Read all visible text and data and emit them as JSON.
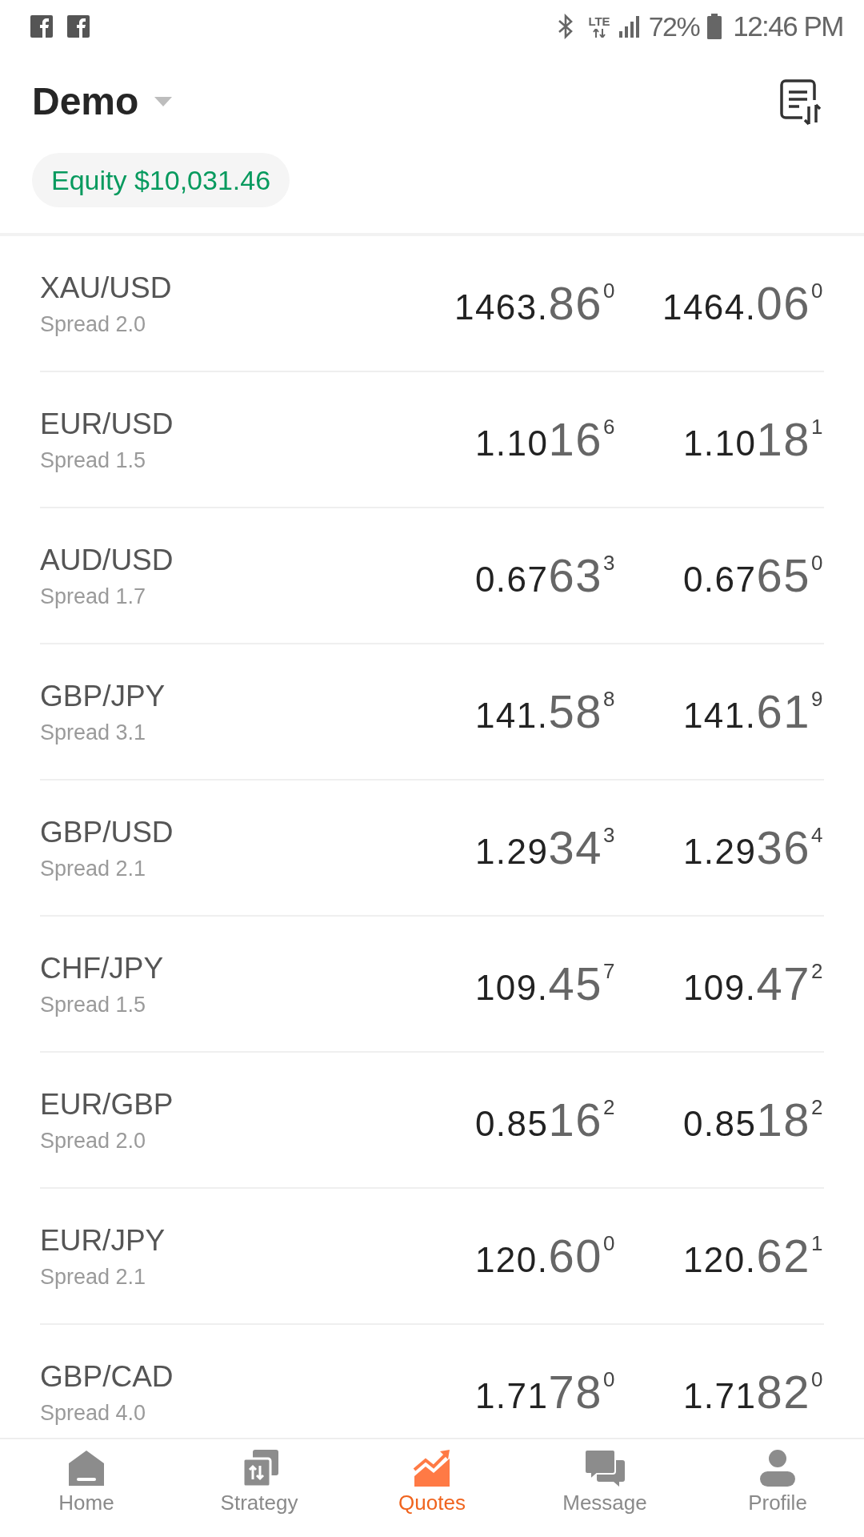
{
  "status_bar": {
    "network": "LTE",
    "battery": "72%",
    "time": "12:46 PM"
  },
  "header": {
    "account": "Demo",
    "equity": "Equity $10,031.46"
  },
  "quotes": [
    {
      "pair": "XAU/USD",
      "spread": "Spread 2.0",
      "bid": {
        "lead": "1463.",
        "pips": "86",
        "fraction": "0"
      },
      "ask": {
        "lead": "1464.",
        "pips": "06",
        "fraction": "0"
      }
    },
    {
      "pair": "EUR/USD",
      "spread": "Spread 1.5",
      "bid": {
        "lead": "1.10",
        "pips": "16",
        "fraction": "6"
      },
      "ask": {
        "lead": "1.10",
        "pips": "18",
        "fraction": "1"
      }
    },
    {
      "pair": "AUD/USD",
      "spread": "Spread 1.7",
      "bid": {
        "lead": "0.67",
        "pips": "63",
        "fraction": "3"
      },
      "ask": {
        "lead": "0.67",
        "pips": "65",
        "fraction": "0"
      }
    },
    {
      "pair": "GBP/JPY",
      "spread": "Spread 3.1",
      "bid": {
        "lead": "141.",
        "pips": "58",
        "fraction": "8"
      },
      "ask": {
        "lead": "141.",
        "pips": "61",
        "fraction": "9"
      }
    },
    {
      "pair": "GBP/USD",
      "spread": "Spread 2.1",
      "bid": {
        "lead": "1.29",
        "pips": "34",
        "fraction": "3"
      },
      "ask": {
        "lead": "1.29",
        "pips": "36",
        "fraction": "4"
      }
    },
    {
      "pair": "CHF/JPY",
      "spread": "Spread 1.5",
      "bid": {
        "lead": "109.",
        "pips": "45",
        "fraction": "7"
      },
      "ask": {
        "lead": "109.",
        "pips": "47",
        "fraction": "2"
      }
    },
    {
      "pair": "EUR/GBP",
      "spread": "Spread 2.0",
      "bid": {
        "lead": "0.85",
        "pips": "16",
        "fraction": "2"
      },
      "ask": {
        "lead": "0.85",
        "pips": "18",
        "fraction": "2"
      }
    },
    {
      "pair": "EUR/JPY",
      "spread": "Spread 2.1",
      "bid": {
        "lead": "120.",
        "pips": "60",
        "fraction": "0"
      },
      "ask": {
        "lead": "120.",
        "pips": "62",
        "fraction": "1"
      }
    },
    {
      "pair": "GBP/CAD",
      "spread": "Spread 4.0",
      "bid": {
        "lead": "1.71",
        "pips": "78",
        "fraction": "0"
      },
      "ask": {
        "lead": "1.71",
        "pips": "82",
        "fraction": "0"
      }
    }
  ],
  "nav": [
    {
      "label": "Home",
      "selected": false
    },
    {
      "label": "Strategy",
      "selected": false
    },
    {
      "label": "Quotes",
      "selected": true
    },
    {
      "label": "Message",
      "selected": false
    },
    {
      "label": "Profile",
      "selected": false
    }
  ]
}
